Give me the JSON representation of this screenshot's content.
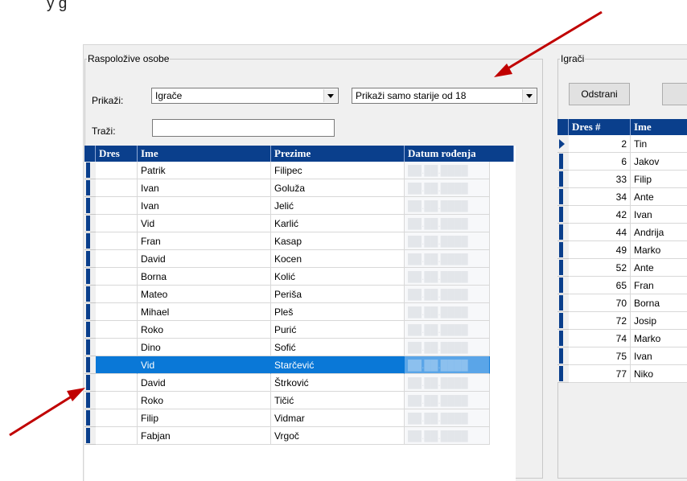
{
  "partial_text": "y g",
  "left_group": {
    "title": "Raspoložive osobe",
    "show_label": "Prikaži:",
    "show_value": "Igrače",
    "filter_value": "Prikaži samo starije od 18",
    "search_label": "Traži:",
    "search_value": "",
    "columns": [
      "Dres",
      "Ime",
      "Prezime",
      "Datum rođenja"
    ],
    "rows": [
      {
        "dres": "",
        "ime": "Patrik",
        "prezime": "Filipec",
        "datum": "██.██.████"
      },
      {
        "dres": "",
        "ime": "Ivan",
        "prezime": "Goluža",
        "datum": "██.██.████"
      },
      {
        "dres": "",
        "ime": "Ivan",
        "prezime": "Jelić",
        "datum": "██.██.████"
      },
      {
        "dres": "",
        "ime": "Vid",
        "prezime": "Karlić",
        "datum": "██.██.████"
      },
      {
        "dres": "",
        "ime": "Fran",
        "prezime": "Kasap",
        "datum": "██.██.████"
      },
      {
        "dres": "",
        "ime": "David",
        "prezime": "Kocen",
        "datum": "██.██.████"
      },
      {
        "dres": "",
        "ime": "Borna",
        "prezime": "Kolić",
        "datum": "██.██.████"
      },
      {
        "dres": "",
        "ime": "Mateo",
        "prezime": "Periša",
        "datum": "██.██.████"
      },
      {
        "dres": "",
        "ime": "Mihael",
        "prezime": "Pleš",
        "datum": "██.██.████"
      },
      {
        "dres": "",
        "ime": "Roko",
        "prezime": "Purić",
        "datum": "██.██.████"
      },
      {
        "dres": "",
        "ime": "Dino",
        "prezime": "Sofić",
        "datum": "██.██.████"
      },
      {
        "dres": "",
        "ime": "Vid",
        "prezime": "Starčević",
        "datum": "██.██.████"
      },
      {
        "dres": "",
        "ime": "David",
        "prezime": "Štrković",
        "datum": "██.██.████"
      },
      {
        "dres": "",
        "ime": "Roko",
        "prezime": "Tičić",
        "datum": "██.██.████"
      },
      {
        "dres": "",
        "ime": "Filip",
        "prezime": "Vidmar",
        "datum": "██.██.████"
      },
      {
        "dres": "",
        "ime": "Fabjan",
        "prezime": "Vrgoč",
        "datum": "██.██.████"
      }
    ],
    "selected_index": 11
  },
  "right_group": {
    "title": "Igrači",
    "remove_button": "Odstrani",
    "columns": [
      "Dres #",
      "Ime"
    ],
    "rows": [
      {
        "dres": "2",
        "ime": "Tin"
      },
      {
        "dres": "6",
        "ime": "Jakov"
      },
      {
        "dres": "33",
        "ime": "Filip"
      },
      {
        "dres": "34",
        "ime": "Ante"
      },
      {
        "dres": "42",
        "ime": "Ivan"
      },
      {
        "dres": "44",
        "ime": "Andrija"
      },
      {
        "dres": "49",
        "ime": "Marko"
      },
      {
        "dres": "52",
        "ime": "Ante"
      },
      {
        "dres": "65",
        "ime": "Fran"
      },
      {
        "dres": "70",
        "ime": "Borna"
      },
      {
        "dres": "72",
        "ime": "Josip"
      },
      {
        "dres": "74",
        "ime": "Marko"
      },
      {
        "dres": "75",
        "ime": "Ivan"
      },
      {
        "dres": "77",
        "ime": "Niko"
      }
    ],
    "current_index": 0
  },
  "colors": {
    "header_bg": "#0a3f8c",
    "selection_bg": "#0a78d7",
    "annotation_arrow": "#c00000"
  }
}
